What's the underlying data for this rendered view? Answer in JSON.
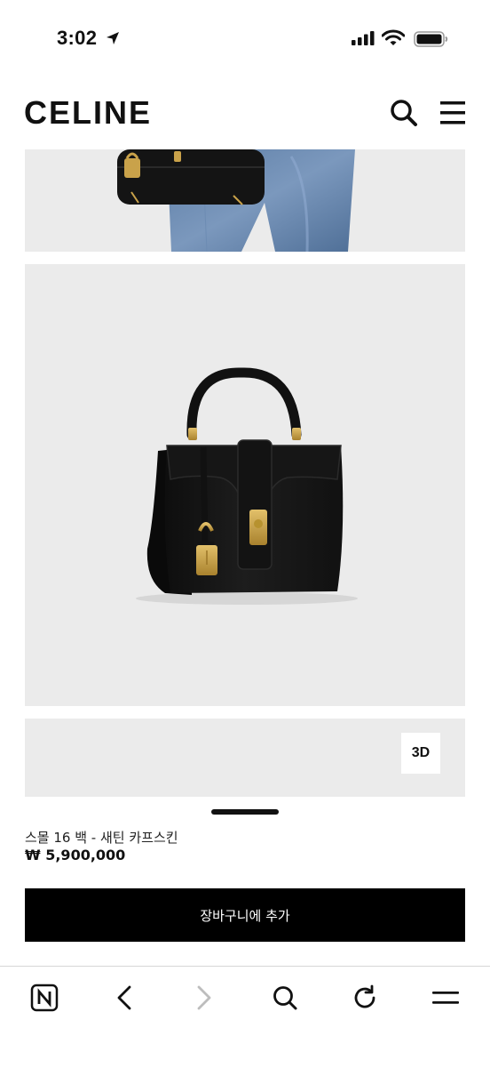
{
  "status_bar": {
    "time": "3:02"
  },
  "header": {
    "logo": "CELINE",
    "icons": [
      "search-icon",
      "hamburger-menu-icon"
    ]
  },
  "gallery": {
    "images": [
      "model-carrying-bag-photo",
      "black-handbag-photo",
      "3d-view-panel"
    ],
    "three_d_label": "3D"
  },
  "product": {
    "name": "스몰 16 백 - 새틴 카프스킨",
    "price": "₩ 5,900,000"
  },
  "actions": {
    "add_to_cart": "장바구니에 추가"
  },
  "browser_toolbar": {
    "icons": [
      "naver-n-icon",
      "back-arrow-icon",
      "forward-arrow-icon",
      "search-icon",
      "reload-icon",
      "menu-icon"
    ]
  },
  "colors": {
    "accent": "#000000",
    "panel_bg": "#ebebeb",
    "gold_hardware": "#c9a24a"
  }
}
